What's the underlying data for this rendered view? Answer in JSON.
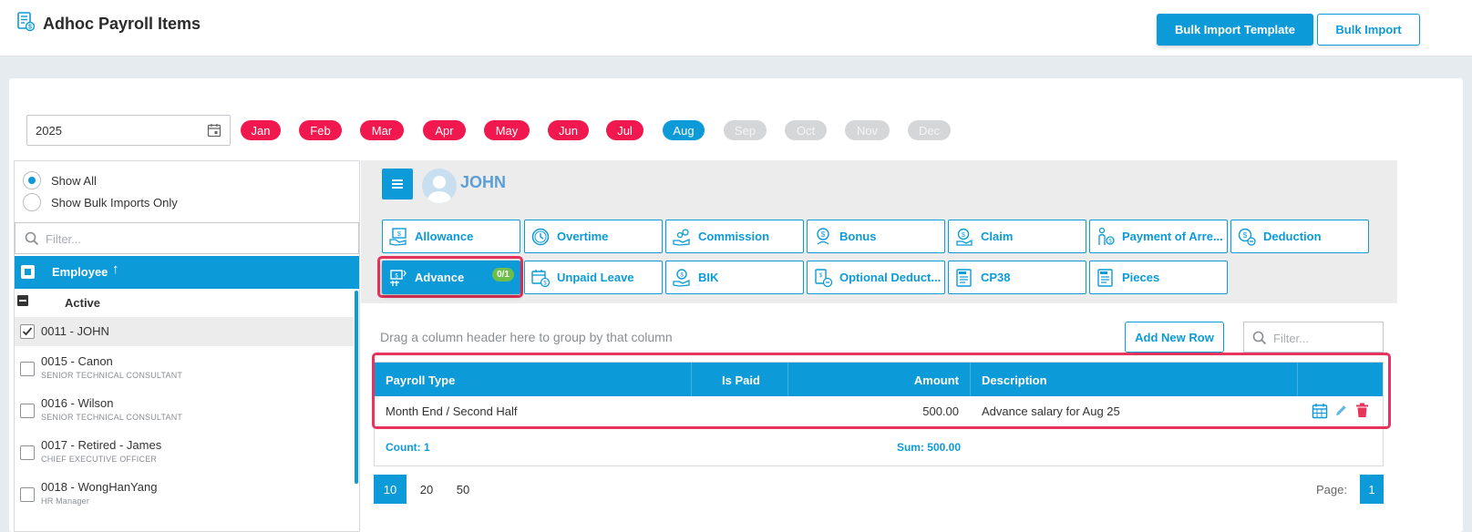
{
  "header": {
    "title": "Adhoc Payroll Items",
    "bulk_template_label": "Bulk Import Template",
    "bulk_import_label": "Bulk Import"
  },
  "filters": {
    "year": "2025",
    "months": [
      {
        "label": "Jan",
        "state": "red"
      },
      {
        "label": "Feb",
        "state": "red"
      },
      {
        "label": "Mar",
        "state": "red"
      },
      {
        "label": "Apr",
        "state": "red"
      },
      {
        "label": "May",
        "state": "red"
      },
      {
        "label": "Jun",
        "state": "red"
      },
      {
        "label": "Jul",
        "state": "red"
      },
      {
        "label": "Aug",
        "state": "blue"
      },
      {
        "label": "Sep",
        "state": "grey"
      },
      {
        "label": "Oct",
        "state": "grey"
      },
      {
        "label": "Nov",
        "state": "grey"
      },
      {
        "label": "Dec",
        "state": "grey"
      }
    ]
  },
  "left": {
    "radio_all": "Show All",
    "radio_bulk": "Show Bulk Imports Only",
    "filter_placeholder": "Filter...",
    "column": "Employee",
    "sort_icon": "↑",
    "group": "Active",
    "employees": [
      {
        "name": "0011 - JOHN",
        "title": "",
        "checked": true
      },
      {
        "name": "0015 - Canon",
        "title": "SENIOR TECHNICAL CONSULTANT",
        "checked": false
      },
      {
        "name": "0016 - Wilson",
        "title": "SENIOR TECHNICAL CONSULTANT",
        "checked": false
      },
      {
        "name": "0017 - Retired - James",
        "title": "CHIEF EXECUTIVE OFFICER",
        "checked": false
      },
      {
        "name": "0018 - WongHanYang",
        "title": "HR Manager",
        "checked": false
      }
    ]
  },
  "employee": {
    "name": "JOHN"
  },
  "tabs": {
    "allowance": "Allowance",
    "overtime": "Overtime",
    "commission": "Commission",
    "bonus": "Bonus",
    "claim": "Claim",
    "payment_arrears": "Payment of Arre...",
    "deduction": "Deduction",
    "advance": "Advance",
    "advance_badge": "0/1",
    "unpaid_leave": "Unpaid Leave",
    "bik": "BIK",
    "optional_deduct": "Optional Deduct...",
    "cp38": "CP38",
    "pieces": "Pieces"
  },
  "grid": {
    "group_hint": "Drag a column header here to group by that column",
    "add_row": "Add New Row",
    "filter_placeholder": "Filter...",
    "columns": {
      "payroll_type": "Payroll Type",
      "is_paid": "Is Paid",
      "amount": "Amount",
      "description": "Description"
    },
    "row": {
      "payroll_type": "Month End / Second Half",
      "is_paid": "",
      "amount": "500.00",
      "description": "Advance salary for Aug 25"
    },
    "count": "Count: 1",
    "sum": "Sum: 500.00"
  },
  "pager": {
    "sizes": [
      "10",
      "20",
      "50"
    ],
    "page_label": "Page:",
    "current_page": "1"
  },
  "colors": {
    "accent": "#0d9ad8",
    "month_active": "#f0184e",
    "highlight": "#e8335c",
    "delete": "#e8335c"
  }
}
